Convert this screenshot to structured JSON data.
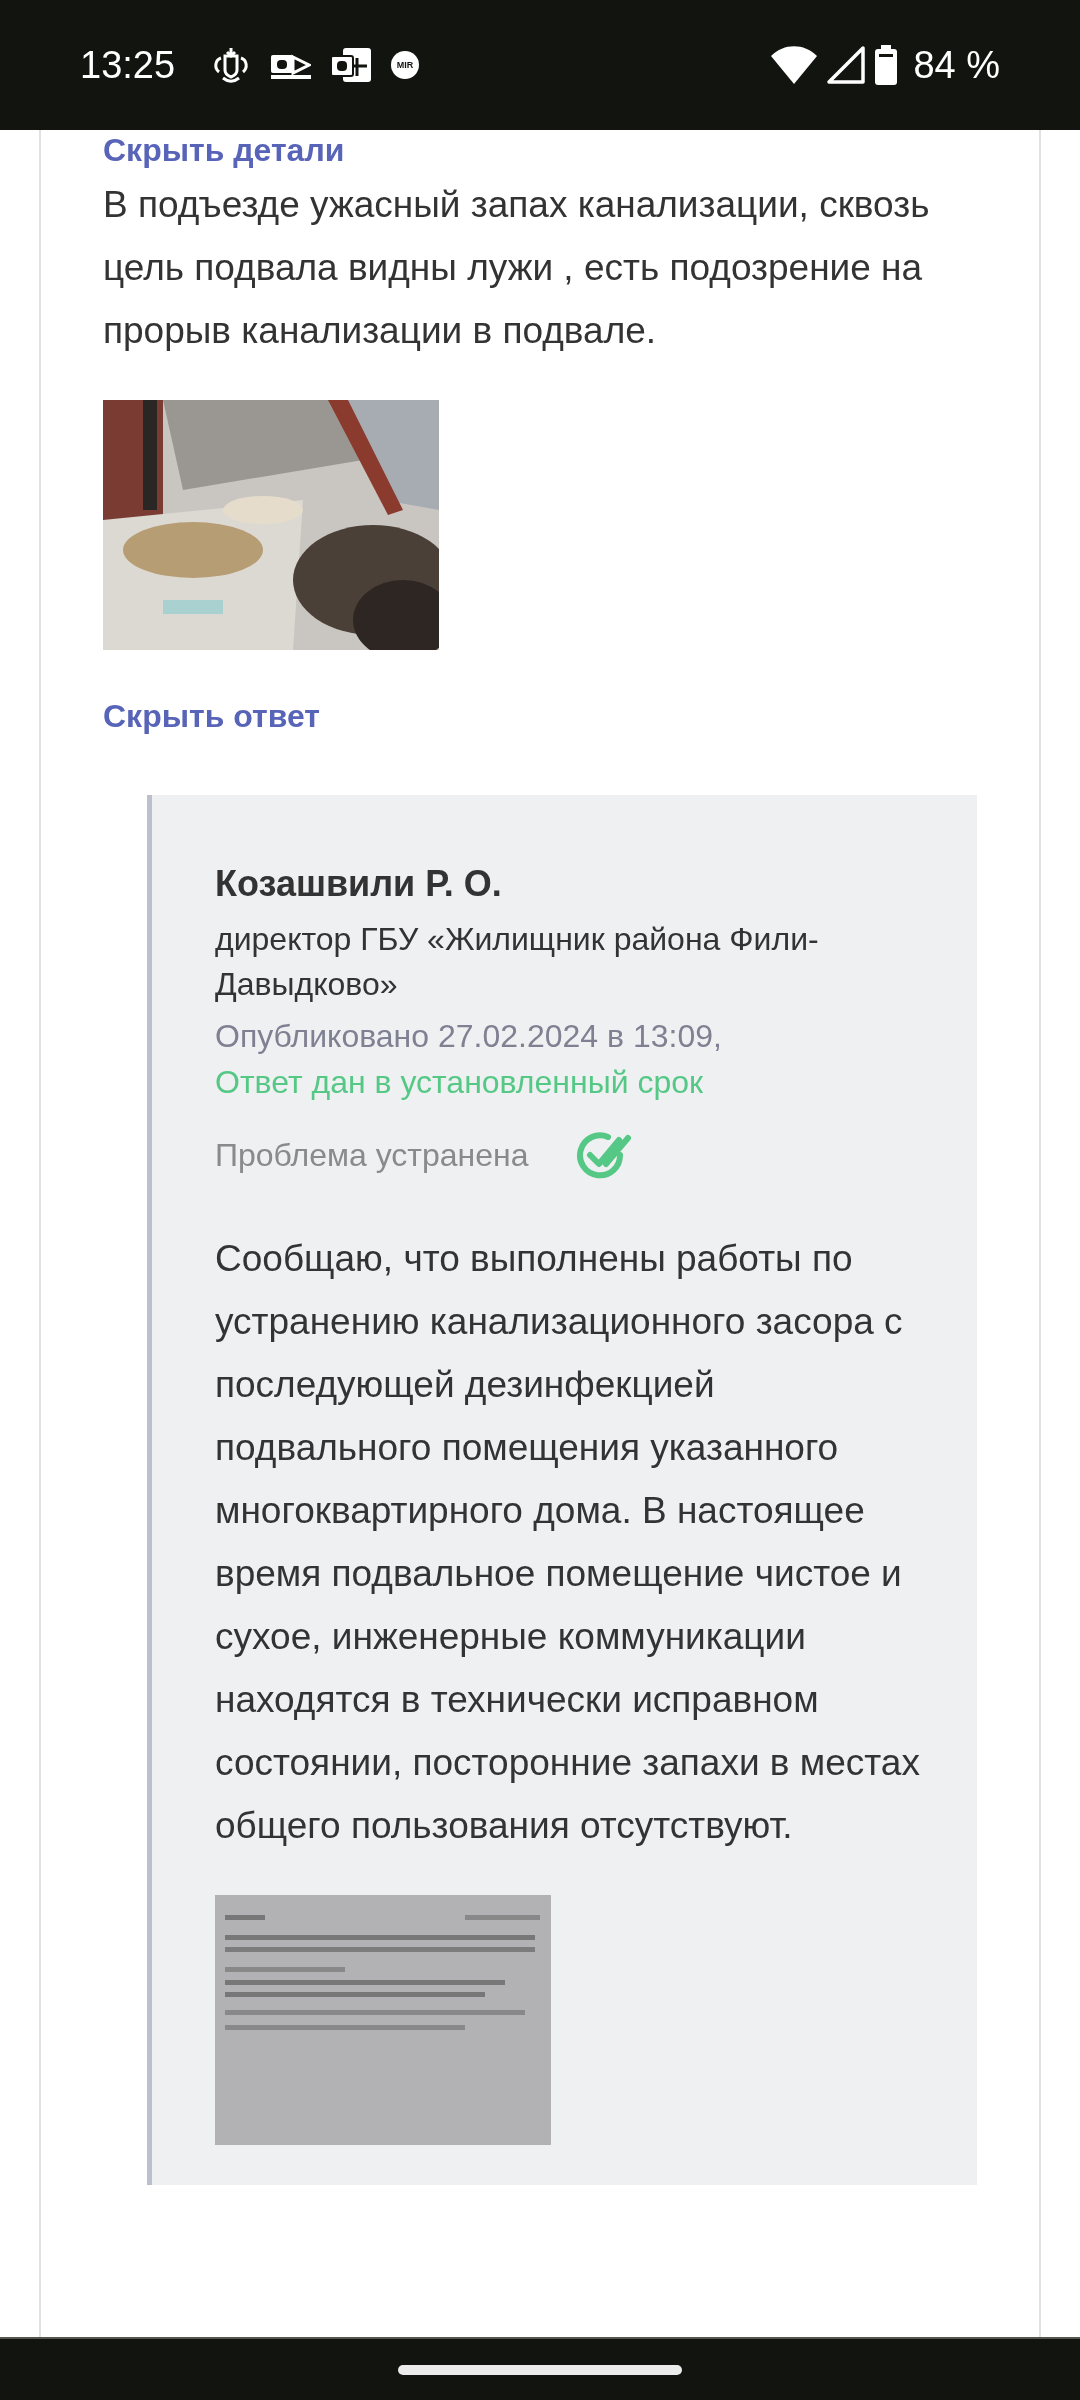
{
  "status_bar": {
    "time": "13:25",
    "mir_badge": "MIR",
    "battery": "84 %"
  },
  "report": {
    "hide_details_link": "Скрыть детали",
    "description": "В подъезде ужасный запах канализации, сквозь цель подвала видны лужи , есть подозрение на прорыв канализации в подвале.",
    "hide_answer_link": "Скрыть ответ"
  },
  "answer": {
    "author": "Козашвили Р. О.",
    "position": "директор ГБУ «Жилищник района Фили-Давыдково»",
    "published": "Опубликовано 27.02.2024 в 13:09,",
    "deadline_note": "Ответ дан в установленный срок",
    "status": "Проблема устранена",
    "resolved": true,
    "text": "Сообщаю, что выполнены работы по устранению канализационного засора с последующей дезинфекцией подвального помещения указанного многоквартирного дома. В настоящее время подвальное помещение чистое и сухое, инженерные коммуникации находятся в технически исправном состоянии, посторонние запахи в местах общего пользования отсутствуют."
  }
}
